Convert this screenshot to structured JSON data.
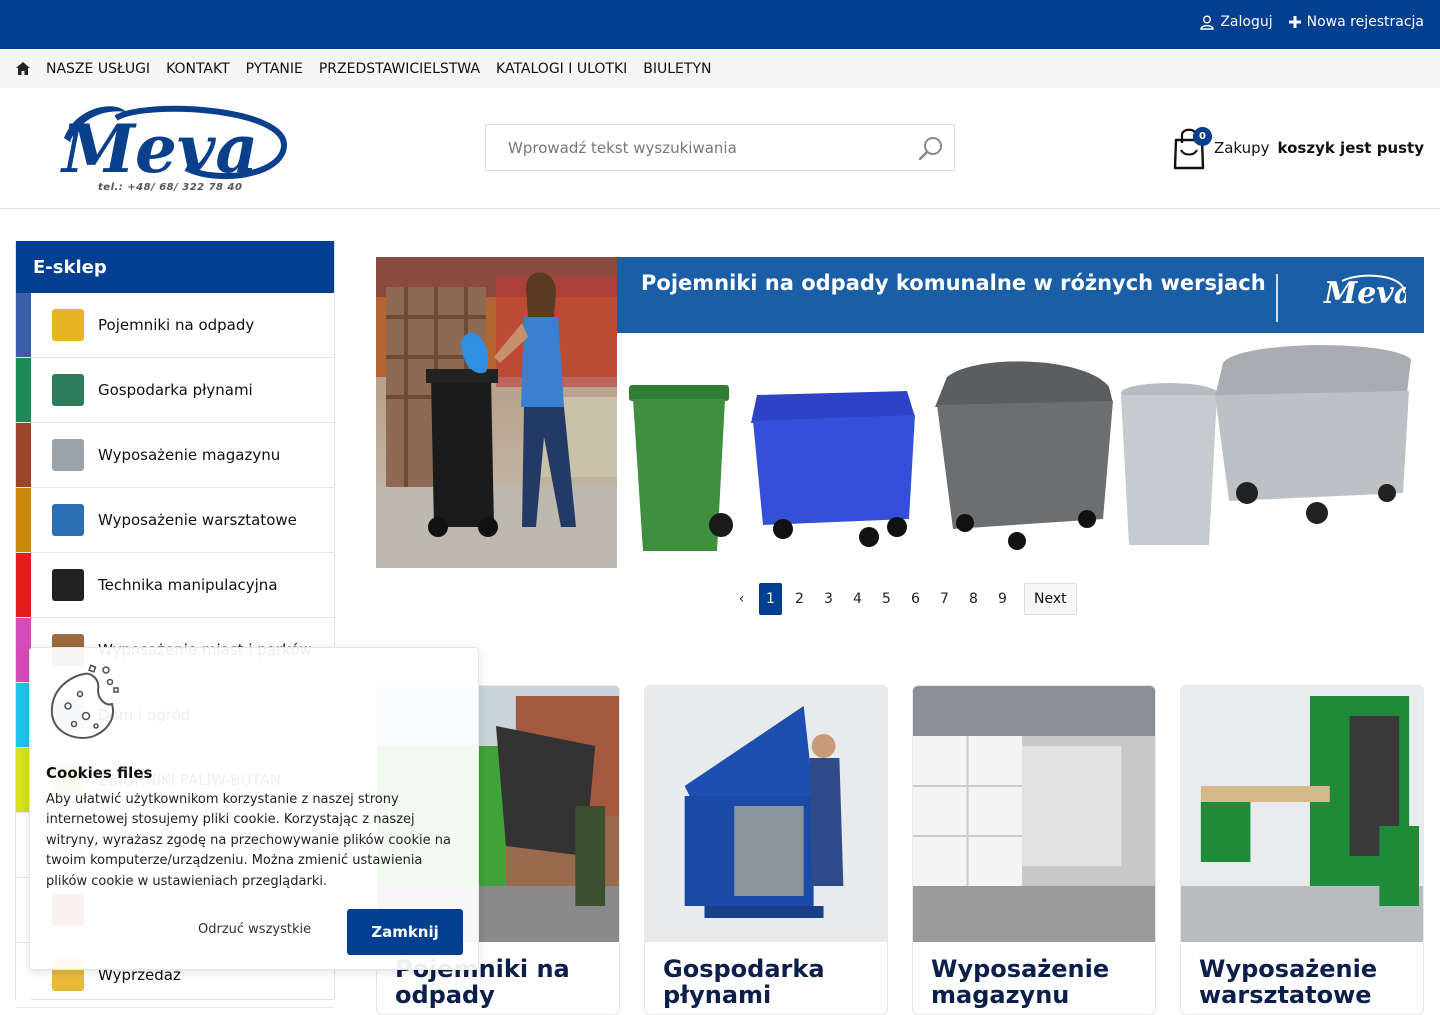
{
  "topbar": {
    "login": "Zaloguj",
    "register": "Nowa rejestracja"
  },
  "nav": {
    "items": [
      "NASZE USŁUGI",
      "KONTAKT",
      "PYTANIE",
      "PRZEDSTAWICIELSTWA",
      "KATALOGI I ULOTKI",
      "BIULETYN"
    ]
  },
  "header": {
    "logo_text": "Meva",
    "phone": "tel.: +48/ 68/ 322 78 40",
    "search_placeholder": "Wprowadź tekst wyszukiwania",
    "cart": {
      "count": "0",
      "label": "Zakupy",
      "status": "koszyk jest pusty"
    }
  },
  "sidebar": {
    "title": "E-sklep",
    "items": [
      {
        "label": "Pojemniki na odpady",
        "color": "#3b5ea8"
      },
      {
        "label": "Gospodarka płynami",
        "color": "#1d8a56"
      },
      {
        "label": "Wyposażenie magazynu",
        "color": "#a0432c"
      },
      {
        "label": "Wyposażenie warsztatowe",
        "color": "#c9870b"
      },
      {
        "label": "Technika manipulacyjna",
        "color": "#e31d1d"
      },
      {
        "label": "Wyposażenie miast i parków",
        "color": "#d44cb8"
      },
      {
        "label": "Dom i ogród",
        "color": "#1fc4ec"
      },
      {
        "label": "ZBIORNIKI PALIW-BUTAN",
        "color": "#d6e21e"
      },
      {
        "label": "",
        "color": "#ffffff"
      },
      {
        "label": "",
        "color": "#ffffff"
      },
      {
        "label": "Wyprzedaż",
        "color": "#ffffff"
      }
    ]
  },
  "slider": {
    "title": "Pojemniki na odpady komunalne w różnych wersjach",
    "logo_text": "Meva",
    "pages": [
      "1",
      "2",
      "3",
      "4",
      "5",
      "6",
      "7",
      "8",
      "9"
    ],
    "active_page": "1",
    "prev_label": "‹",
    "next_label": "Next"
  },
  "cards": [
    {
      "title": "Pojemniki na odpady"
    },
    {
      "title": "Gospodarka płynami"
    },
    {
      "title": "Wyposażenie magazynu"
    },
    {
      "title": "Wyposażenie warsztatowe"
    }
  ],
  "cookie": {
    "title": "Cookies files",
    "text": "Aby ułatwić użytkownikom korzystanie z naszej strony internetowej stosujemy pliki cookie. Korzystając z naszej witryny, wyrażasz zgodę na przechowywanie plików cookie na twoim komputerze/urządzeniu. Można zmienić ustawienia plików cookie w ustawieniach przeglądarki.",
    "reject": "Odrzuć wszystkie",
    "close": "Zamknij"
  },
  "colors": {
    "brand_blue": "#023f91",
    "banner_blue": "#1a5fa6"
  }
}
